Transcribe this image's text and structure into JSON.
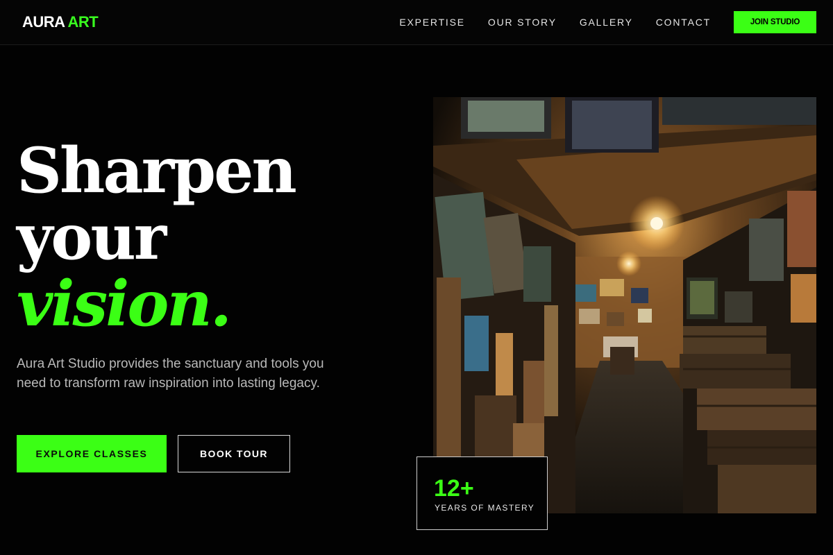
{
  "brand": {
    "name_part1": "AURA",
    "name_part2": "ART",
    "accent_color": "#3bff15"
  },
  "nav": {
    "items": [
      {
        "label": "EXPERTISE"
      },
      {
        "label": "OUR STORY"
      },
      {
        "label": "GALLERY"
      },
      {
        "label": "CONTACT"
      }
    ],
    "cta_label": "JOIN STUDIO"
  },
  "hero": {
    "headline_line1": "Sharpen",
    "headline_line2": "your",
    "headline_line3": "vision.",
    "lead": "Aura Art Studio provides the sanctuary and tools you need to transform raw inspiration into lasting legacy.",
    "primary_button": "EXPLORE CLASSES",
    "secondary_button": "BOOK TOUR"
  },
  "stat": {
    "value": "12+",
    "label": "YEARS OF MASTERY"
  },
  "image": {
    "subject": "art-studio-gallery-photo"
  }
}
